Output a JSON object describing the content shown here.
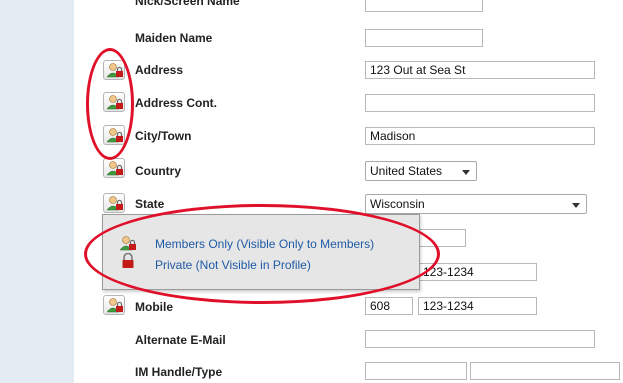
{
  "form": {
    "rows": [
      {
        "label": "Nick/Screen Name"
      },
      {
        "label": "Maiden Name"
      },
      {
        "label": "Address",
        "value": "123 Out at Sea St"
      },
      {
        "label": "Address Cont.",
        "value": ""
      },
      {
        "label": "City/Town",
        "value": "Madison"
      },
      {
        "label": "Country",
        "value": "United States"
      },
      {
        "label": "State",
        "value": "Wisconsin"
      },
      {
        "label": "Mobile",
        "area": "608",
        "number": "123-1234"
      },
      {
        "label": "Alternate E-Mail",
        "value": ""
      },
      {
        "label": "IM Handle/Type",
        "value": ""
      }
    ],
    "hidden_row_number": "123-1234"
  },
  "privacy_menu": {
    "options": [
      {
        "label": "Members Only (Visible Only to Members)",
        "icon": "members-only-icon"
      },
      {
        "label": "Private (Not Visible in Profile)",
        "icon": "lock-icon"
      }
    ]
  },
  "colors": {
    "annotation": "#e0102a",
    "link": "#1f5aa5",
    "side_panel": "#e3ebf3"
  }
}
